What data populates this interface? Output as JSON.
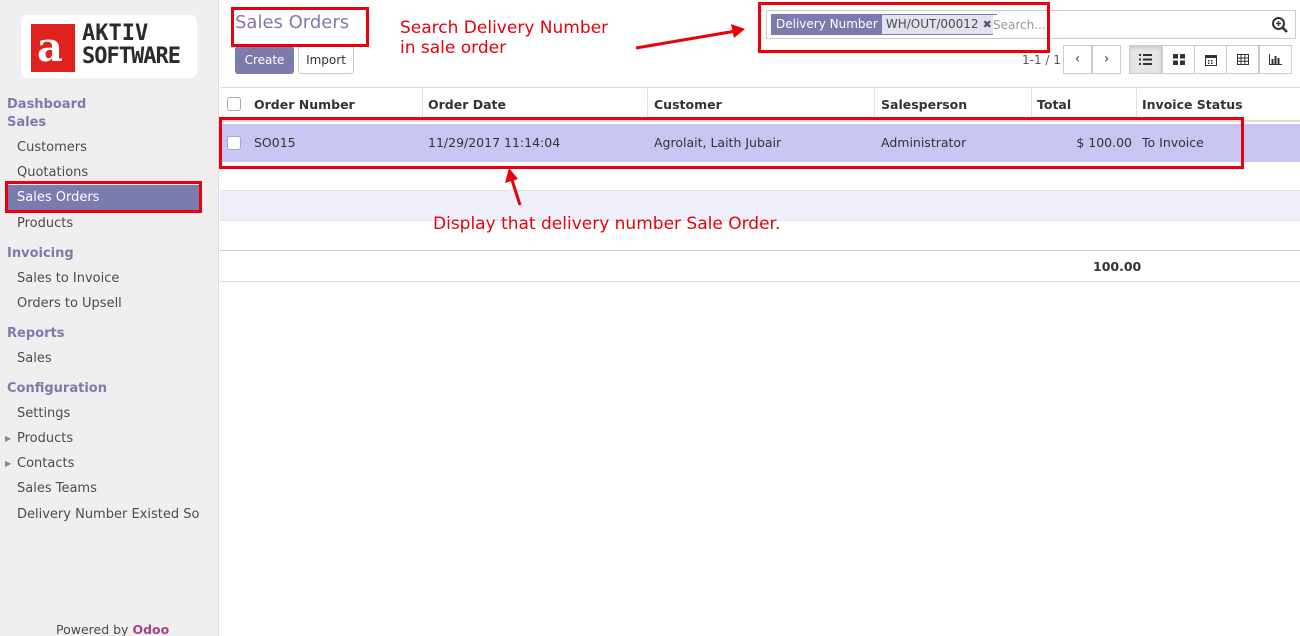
{
  "brand": {
    "logo_letter": "a",
    "logo_line1": "AKTIV",
    "logo_line2": "SOFTWARE"
  },
  "sidebar": {
    "sections": [
      {
        "label": "Dashboard"
      },
      {
        "label": "Sales"
      },
      {
        "label": "Invoicing"
      },
      {
        "label": "Reports"
      },
      {
        "label": "Configuration"
      }
    ],
    "items": [
      {
        "label": "Customers"
      },
      {
        "label": "Quotations"
      },
      {
        "label": "Sales Orders"
      },
      {
        "label": "Products"
      },
      {
        "label": "Sales to Invoice"
      },
      {
        "label": "Orders to Upsell"
      },
      {
        "label": "Sales"
      },
      {
        "label": "Settings"
      },
      {
        "label": "Products"
      },
      {
        "label": "Contacts"
      },
      {
        "label": "Sales Teams"
      },
      {
        "label": "Delivery Number Existed So"
      }
    ],
    "powered_prefix": "Powered by",
    "powered_brand": "Odoo"
  },
  "control": {
    "title": "Sales Orders",
    "create_label": "Create",
    "import_label": "Import"
  },
  "search": {
    "facet_key": "Delivery Number",
    "facet_value": "WH/OUT/00012",
    "placeholder": "Search..."
  },
  "pager": {
    "text": "1-1 / 1"
  },
  "table": {
    "columns": [
      "Order Number",
      "Order Date",
      "Customer",
      "Salesperson",
      "Total",
      "Invoice Status"
    ],
    "rows": [
      {
        "order_number": "SO015",
        "order_date": "11/29/2017 11:14:04",
        "customer": "Agrolait, Laith Jubair",
        "salesperson": "Administrator",
        "total": "$ 100.00",
        "invoice_status": "To Invoice"
      }
    ],
    "footer_total": "100.00"
  },
  "annotations": {
    "search_note_line1": "Search Delivery Number",
    "search_note_line2": "in sale order",
    "display_note": "Display that delivery number Sale Order."
  },
  "colors": {
    "accent": "#7c7bad",
    "annotation": "#e8000d",
    "selected_row": "#c8c7f4",
    "logo_red": "#e0211d"
  }
}
